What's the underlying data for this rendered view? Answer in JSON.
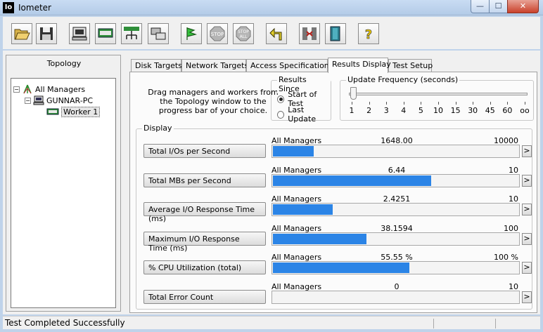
{
  "window": {
    "title": "Iometer",
    "icon_text": "Io",
    "accent": "#2b84e6"
  },
  "toolbar": {
    "buttons": [
      {
        "name": "open-config-button",
        "icon": "folder-open-icon"
      },
      {
        "name": "save-config-button",
        "icon": "floppy-disk-icon"
      },
      {
        "name": "new-disk-worker-button",
        "icon": "computer-icon"
      },
      {
        "name": "new-network-worker-button",
        "icon": "network-worker-icon"
      },
      {
        "name": "duplicate-worker-button",
        "icon": "network-tree-icon"
      },
      {
        "name": "disconnect-manager-button",
        "icon": "monitors-icon"
      },
      {
        "name": "start-tests-button",
        "icon": "green-flag-icon"
      },
      {
        "name": "stop-test-button",
        "icon": "stop-sign-icon",
        "label": "STOP"
      },
      {
        "name": "stop-all-button",
        "icon": "stop-all-sign-icon",
        "label": "STOP",
        "sublabel": "ALL"
      },
      {
        "name": "reset-workers-button",
        "icon": "return-arrow-icon"
      },
      {
        "name": "exit-button",
        "icon": "exit-door-icon"
      },
      {
        "name": "about-button",
        "icon": "question-mark-icon",
        "label": "?"
      }
    ]
  },
  "topology": {
    "title": "Topology",
    "tree": [
      {
        "label": "All Managers",
        "expander": "−",
        "icon": "managers-icon"
      },
      {
        "label": "GUNNAR-PC",
        "expander": "−",
        "icon": "computer-icon"
      },
      {
        "label": "Worker 1",
        "icon": "worker-disk-icon",
        "selected": true
      }
    ]
  },
  "tabs": [
    {
      "label": "Disk Targets",
      "active": false
    },
    {
      "label": "Network Targets",
      "active": false
    },
    {
      "label": "Access Specifications",
      "active": false
    },
    {
      "label": "Results Display",
      "active": true
    },
    {
      "label": "Test Setup",
      "active": false
    }
  ],
  "results_display": {
    "drag_message": "Drag managers and workers from the Topology window to the progress bar of your choice.",
    "results_since": {
      "title": "Results Since",
      "options": [
        {
          "label": "Start of Test",
          "checked": true
        },
        {
          "label": "Last Update",
          "checked": false
        }
      ]
    },
    "update_frequency": {
      "title": "Update Frequency (seconds)",
      "ticks": [
        "1",
        "2",
        "3",
        "4",
        "5",
        "10",
        "15",
        "30",
        "45",
        "60",
        "oo"
      ],
      "selected_index": 0
    },
    "display": {
      "title": "Display",
      "rows": [
        {
          "button": "Total I/Os per Second",
          "source": "All Managers",
          "value": "1648.00",
          "max": "10000",
          "fraction": 0.1648,
          "more": ">"
        },
        {
          "button": "Total MBs per Second",
          "source": "All Managers",
          "value": "6.44",
          "max": "10",
          "fraction": 0.644,
          "more": ">"
        },
        {
          "button": "Average I/O Response Time (ms)",
          "source": "All Managers",
          "value": "2.4251",
          "max": "10",
          "fraction": 0.24251,
          "more": ">"
        },
        {
          "button": "Maximum I/O Response Time (ms)",
          "source": "All Managers",
          "value": "38.1594",
          "max": "100",
          "fraction": 0.381594,
          "more": ">"
        },
        {
          "button": "% CPU Utilization (total)",
          "source": "All Managers",
          "value": "55.55 %",
          "max": "100 %",
          "fraction": 0.5555,
          "more": ">"
        },
        {
          "button": "Total Error Count",
          "source": "All Managers",
          "value": "0",
          "max": "10",
          "fraction": 0,
          "more": ">"
        }
      ]
    }
  },
  "status": {
    "text": "Test Completed Successfully"
  }
}
